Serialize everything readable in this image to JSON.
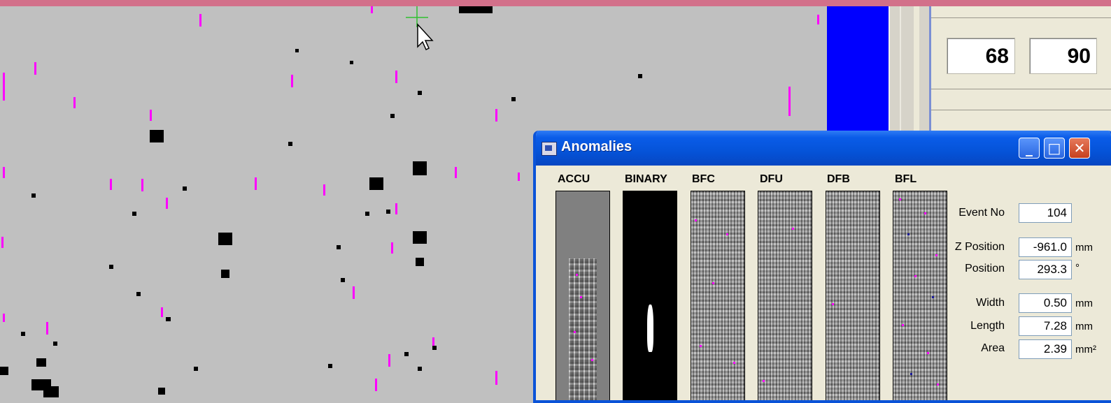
{
  "readout": {
    "value_1": "68",
    "value_2": "90"
  },
  "window": {
    "title": "Anomalies",
    "minimize_label": "_",
    "maximize_label": "□",
    "close_label": "✕"
  },
  "channels": [
    "ACCU",
    "BINARY",
    "BFC",
    "DFU",
    "DFB",
    "BFL"
  ],
  "fields": {
    "event_no": {
      "label": "Event No",
      "value": "104",
      "unit": ""
    },
    "z_position": {
      "label": "Z Position",
      "value": "-961.0",
      "unit": "mm"
    },
    "position": {
      "label": "Position",
      "value": "293.3",
      "unit": "°"
    },
    "width": {
      "label": "Width",
      "value": "0.50",
      "unit": "mm"
    },
    "length": {
      "label": "Length",
      "value": "7.28",
      "unit": "mm"
    },
    "area": {
      "label": "Area",
      "value": "2.39",
      "unit": "mm²"
    }
  },
  "colors": {
    "marker": "#ff00ff",
    "defect": "#000000",
    "background": "#c0c0c0",
    "titlebar": "#0553d8",
    "panel": "#0000ff"
  },
  "icons": [
    "crosshair-icon",
    "mouse-cursor-icon",
    "app-window-icon",
    "minimize-icon",
    "maximize-icon",
    "close-icon"
  ]
}
